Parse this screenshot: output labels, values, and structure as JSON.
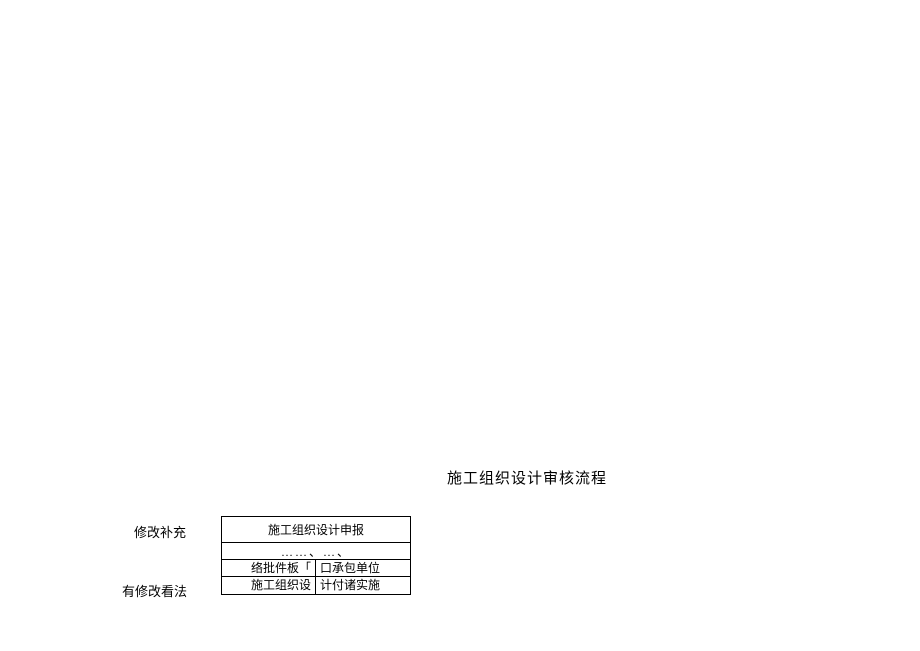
{
  "title": "施工组织设计审核流程",
  "leftLabels": {
    "label1": "修改补充",
    "label2": "有修改看法"
  },
  "table": {
    "row1": "施工组织设计申报",
    "row2": "……、…、",
    "row3_left": "络批件板「",
    "row3_right": "口承包单位",
    "row4_left": "施工组织设",
    "row4_right": "计付诸实施"
  }
}
